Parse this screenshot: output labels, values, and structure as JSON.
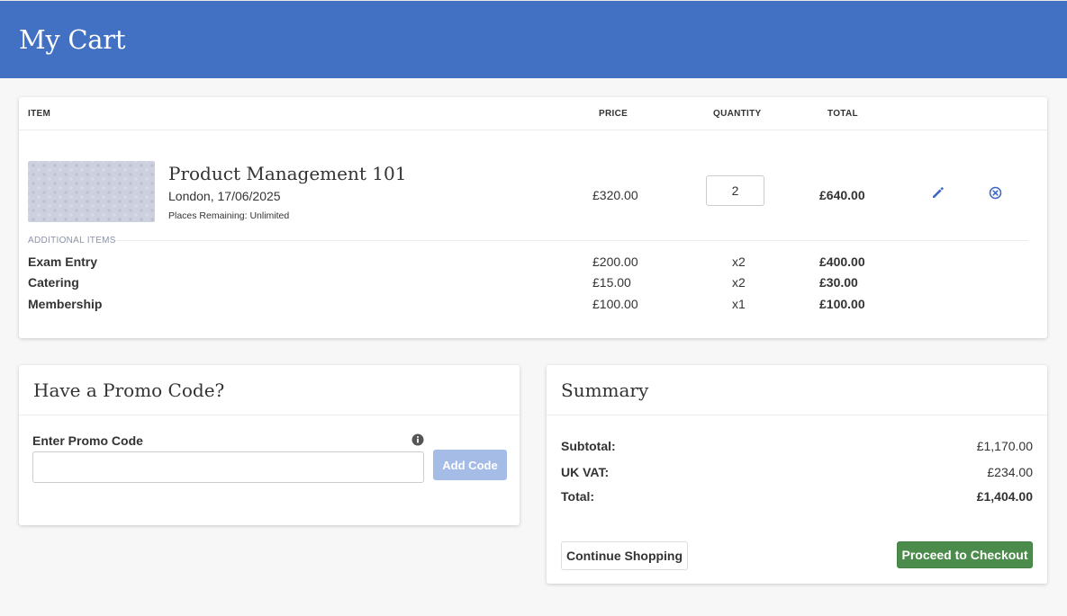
{
  "page": {
    "title": "My Cart"
  },
  "cart": {
    "headers": {
      "item": "ITEM",
      "price": "PRICE",
      "quantity": "QUANTITY",
      "total": "TOTAL"
    },
    "product": {
      "name": "Product Management 101",
      "location_date": "London, 17/06/2025",
      "places_remaining": "Places Remaining: Unlimited",
      "price": "£320.00",
      "quantity": "2",
      "total": "£640.00",
      "edit_icon": "pencil-icon",
      "remove_icon": "close-circle-icon"
    },
    "additional_items_label": "ADDITIONAL ITEMS",
    "additional_items": [
      {
        "name": "Exam Entry",
        "price": "£200.00",
        "quantity": "x2",
        "total": "£400.00"
      },
      {
        "name": "Catering",
        "price": "£15.00",
        "quantity": "x2",
        "total": "£30.00"
      },
      {
        "name": "Membership",
        "price": "£100.00",
        "quantity": "x1",
        "total": "£100.00"
      }
    ]
  },
  "promo": {
    "title": "Have a Promo Code?",
    "label": "Enter Promo Code",
    "value": "",
    "button": "Add Code",
    "info_icon": "info-icon"
  },
  "summary": {
    "title": "Summary",
    "subtotal_label": "Subtotal:",
    "subtotal": "£1,170.00",
    "vat_label": "UK VAT:",
    "vat": "£234.00",
    "total_label": "Total:",
    "total": "£1,404.00",
    "continue_button": "Continue Shopping",
    "checkout_button": "Proceed to Checkout"
  },
  "colors": {
    "header": "#4270c2",
    "accent": "#3a66c4",
    "checkout": "#4b8b4b",
    "add_code_disabled": "#a5bce6"
  }
}
